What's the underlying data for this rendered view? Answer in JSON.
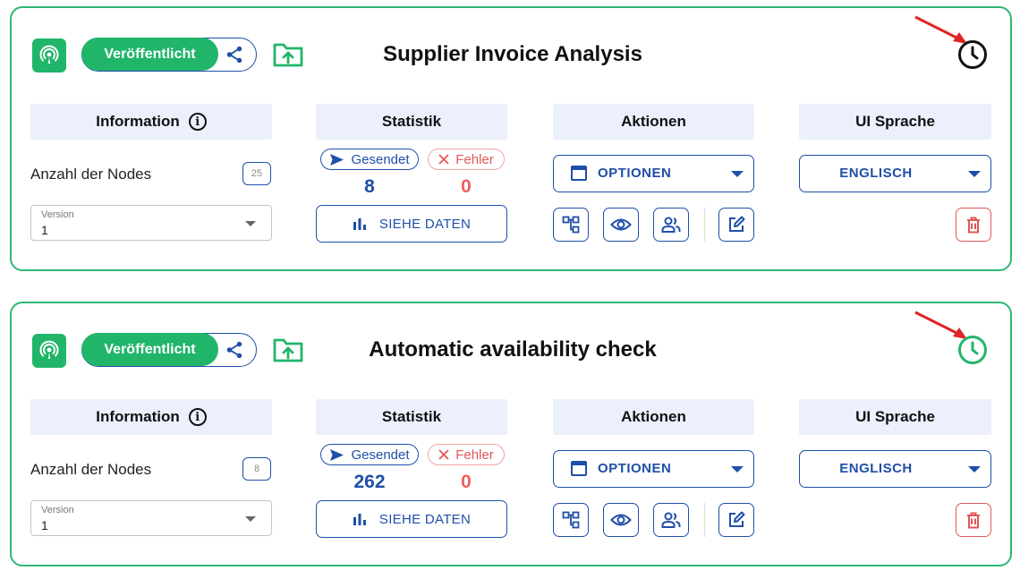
{
  "common": {
    "published_label": "Veröffentlicht",
    "info_header": "Information",
    "stats_header": "Statistik",
    "actions_header": "Aktionen",
    "ui_lang_header": "UI Sprache",
    "nodes_label": "Anzahl der Nodes",
    "version_label": "Version",
    "sent_label": "Gesendet",
    "error_label": "Fehler",
    "view_data_label": "SIEHE DATEN",
    "options_label": "OPTIONEN",
    "colors": {
      "green": "#21b56a",
      "blue": "#1f4fa8",
      "red": "#e25757",
      "header_bg": "#ebf0fc"
    },
    "icons": [
      "podcast-icon",
      "share-icon",
      "folder-upload-icon",
      "clock-icon",
      "info-icon",
      "send-icon",
      "close-icon",
      "bar-chart-icon",
      "window-icon",
      "sitemap-icon",
      "eye-icon",
      "people-icon",
      "edit-icon",
      "trash-icon",
      "caret-down-icon"
    ]
  },
  "workflows": [
    {
      "title": "Supplier Invoice Analysis",
      "nodes_count": "25",
      "version": "1",
      "sent": "8",
      "errors": "0",
      "language": "ENGLISCH",
      "clock_color": "#111111"
    },
    {
      "title": "Automatic availability check",
      "nodes_count": "8",
      "version": "1",
      "sent": "262",
      "errors": "0",
      "language": "ENGLISCH",
      "clock_color": "#21b56a"
    }
  ]
}
